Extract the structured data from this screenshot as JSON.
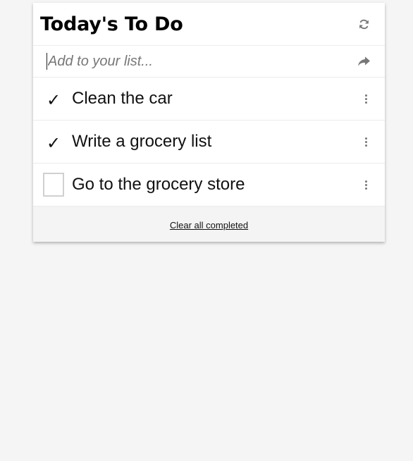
{
  "header": {
    "title": "Today's To Do",
    "refresh_icon": "refresh-icon"
  },
  "add": {
    "placeholder": "Add to your list...",
    "value": "",
    "submit_icon": "share-arrow-icon"
  },
  "todos": [
    {
      "text": "Clean the car",
      "completed": true,
      "check_glyph": "✓"
    },
    {
      "text": "Write a grocery list",
      "completed": true,
      "check_glyph": "✓"
    },
    {
      "text": "Go to the grocery store",
      "completed": false,
      "check_glyph": ""
    }
  ],
  "footer": {
    "clear_label": "Clear all completed"
  },
  "colors": {
    "background": "#f5f5f5",
    "card": "#ffffff",
    "footer": "#f4f4f4",
    "icon": "#777777",
    "checkbox_border": "#d0d0d0"
  }
}
